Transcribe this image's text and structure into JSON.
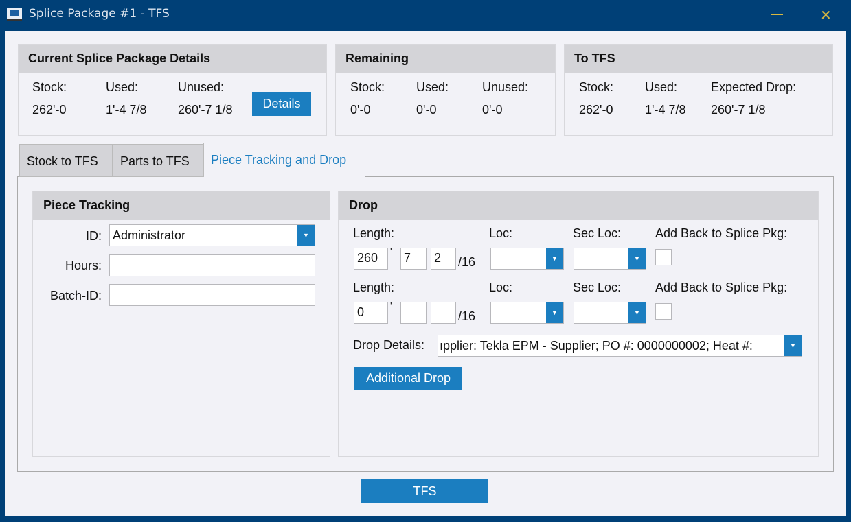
{
  "window": {
    "title": "Splice Package #1 - TFS",
    "minimize": "—",
    "close": "✕"
  },
  "current": {
    "title": "Current Splice Package Details",
    "stock_label": "Stock:",
    "used_label": "Used:",
    "unused_label": "Unused:",
    "stock": "262'-0",
    "used": "1'-4 7/8",
    "unused": "260'-7 1/8",
    "details_button": "Details"
  },
  "remaining": {
    "title": "Remaining",
    "stock_label": "Stock:",
    "used_label": "Used:",
    "unused_label": "Unused:",
    "stock": "0'-0",
    "used": "0'-0",
    "unused": "0'-0"
  },
  "to_tfs": {
    "title": "To TFS",
    "stock_label": "Stock:",
    "used_label": "Used:",
    "drop_label": "Expected Drop:",
    "stock": "262'-0",
    "used": "1'-4 7/8",
    "drop": "260'-7 1/8"
  },
  "tabs": [
    "Stock to TFS",
    "Parts to TFS",
    "Piece Tracking and Drop"
  ],
  "piece": {
    "title": "Piece Tracking",
    "id_label": "ID:",
    "id_value": "Administrator",
    "hours_label": "Hours:",
    "hours_value": "",
    "batch_label": "Batch-ID:",
    "batch_value": ""
  },
  "drop": {
    "title": "Drop",
    "length_label": "Length:",
    "loc_label": "Loc:",
    "sec_loc_label": "Sec Loc:",
    "add_back_label": "Add Back to Splice Pkg:",
    "feet_mark": "'",
    "sixteenths": "/16",
    "rows": [
      {
        "feet": "260",
        "inches": "7",
        "frac": "2"
      },
      {
        "feet": "0",
        "inches": "",
        "frac": ""
      }
    ],
    "details_label": "Drop Details:",
    "details_value": "ıpplier: Tekla EPM - Supplier; PO #: 0000000002; Heat #:",
    "additional_button": "Additional Drop"
  },
  "tfs_button": "TFS"
}
